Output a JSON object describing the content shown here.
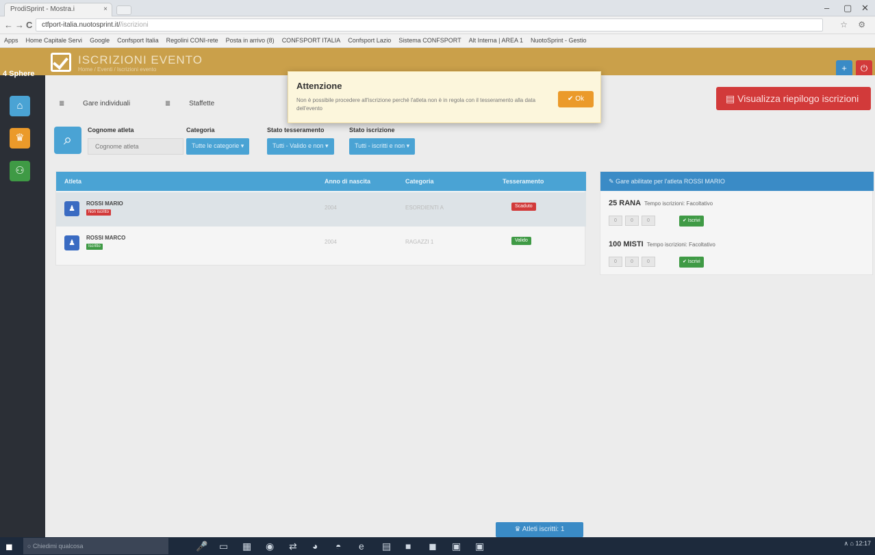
{
  "browser": {
    "tab_title": "ProdiSprint - Mostra.i",
    "tab_close": "×",
    "url": "ctfport-italia.nuotosprint.it/",
    "url_rest": "/iscrizioni",
    "win_min": "–",
    "win_max": "▢",
    "win_close": "✕",
    "back": "←",
    "forward": "→",
    "reload": "C",
    "url_icons": "☆ ⚙",
    "bookmarks": [
      "Apps",
      "Home Capitale Servi",
      "Google",
      "Confsport Italia",
      "Regolini CONI-rete",
      "Posta in arrivo (8)",
      "CONFSPORT ITALIA",
      "Confsport Lazio",
      "Sistema CONFSPORT",
      "Alt Interna | AREA 1",
      "NuotoSprint - Gestio"
    ]
  },
  "app": {
    "brand": "4 Sphere",
    "title": "ISCRIZIONI EVENTO",
    "breadcrumb": "Home / Eventi / Iscrizioni evento",
    "top_add": "+",
    "top_power": "⏻"
  },
  "sidebar": {
    "home_icon": "⌂",
    "trophy_icon": "♛",
    "people_icon": "⚇"
  },
  "subtabs": {
    "individual": "Gare individuali",
    "relay": "Staffette",
    "individual_icon": "≣",
    "relay_icon": "≣"
  },
  "report_button": {
    "icon": "▤",
    "label": "Visualizza riepilogo iscrizioni"
  },
  "filters": {
    "search_icon": "⌕",
    "athlete_label": "Cognome atleta",
    "athlete_placeholder": "Cognome atleta",
    "category_label": "Categoria",
    "category_value": "Tutte le categorie ▾",
    "membership_label": "Stato tesseramento",
    "membership_value": "Tutti - Valido e non ▾",
    "registration_label": "Stato iscrizione",
    "registration_value": "Tutti - iscritti e non ▾"
  },
  "table": {
    "headers": [
      "Atleta",
      "Anno di nascita",
      "Categoria",
      "Tesseramento"
    ],
    "rows": [
      {
        "avatar": "♟",
        "name": "ROSSI MARIO",
        "tag": "Non iscritto",
        "tag_color": "#d23a3a",
        "year": "2004",
        "category": "ESORDIENTI A",
        "status": "Scaduto",
        "status_color": "#d23a3a"
      },
      {
        "avatar": "♟",
        "name": "ROSSI MARCO",
        "tag": "Iscritto",
        "tag_color": "#3f9a45",
        "year": "2004",
        "category": "RAGAZZI 1",
        "status": "Valido",
        "status_color": "#3f9a45"
      }
    ]
  },
  "panel": {
    "header_icon": "✎",
    "header": "Gare abilitate per l'atleta ROSSI MARIO",
    "races": [
      {
        "name": "25 RANA",
        "sub": "Tempo iscrizioni: Facoltativo",
        "fields": [
          "0",
          "0",
          "0"
        ],
        "button": "✔ Iscrivi"
      },
      {
        "name": "100 MISTI",
        "sub": "Tempo iscrizioni: Facoltativo",
        "fields": [
          "0",
          "0",
          "0"
        ],
        "button": "✔ Iscrivi"
      }
    ]
  },
  "modal": {
    "title": "Attenzione",
    "text": "Non è possibile procedere all'iscrizione perché l'atleta non è in regola con il tesseramento alla data dell'evento",
    "ok": "✔ Ok"
  },
  "footer_button": "Atleti iscritti: 1",
  "footer_icon": "♛",
  "taskbar": {
    "start": "◼",
    "search_icon": "○",
    "search": "Chiedimi qualcosa",
    "icons": [
      "🎤",
      "▭",
      "▦",
      "◉",
      "⇄",
      "◕",
      "◓",
      "e",
      "▤",
      "■",
      "◼",
      "▣",
      "▣"
    ],
    "tray": "∧ ⌂  12:17"
  },
  "colors": {
    "accent": "#caa04a",
    "primary": "#4aa3d4",
    "danger": "#d23a3a",
    "success": "#3f9a45",
    "warning": "#eb9a2a"
  }
}
